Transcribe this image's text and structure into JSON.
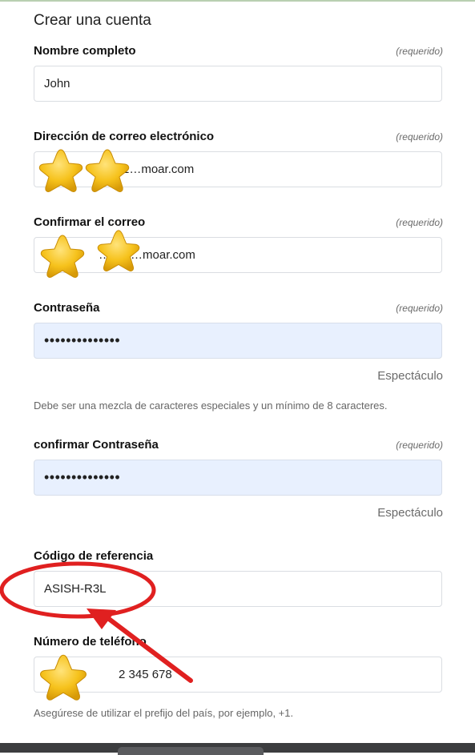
{
  "form": {
    "title": "Crear una cuenta",
    "required_text": "(requerido)",
    "full_name": {
      "label": "Nombre completo",
      "value": "John"
    },
    "email": {
      "label": "Dirección de correo electrónico",
      "value": "1…moar.com"
    },
    "confirm_email": {
      "label": "Confirmar el correo",
      "value": "…194…moar.com"
    },
    "password": {
      "label": "Contraseña",
      "value": "••••••••••••••",
      "show_label": "Espectáculo",
      "hint": "Debe ser una mezcla de caracteres especiales y un mínimo de 8 caracteres."
    },
    "confirm_password": {
      "label": "confirmar Contraseña",
      "value": "••••••••••••••",
      "show_label": "Espectáculo"
    },
    "referral": {
      "label": "Código de referencia",
      "value": "ASISH-R3L"
    },
    "phone": {
      "label": "Número de teléfono",
      "value": "2 345 678",
      "hint": "Asegúrese de utilizar el prefijo del país, por ejemplo, +1."
    }
  },
  "annotation": {
    "color": "#e02020",
    "shape": "circle-and-arrow",
    "target": "referral-code"
  },
  "stickers": {
    "icon": "star-emoji",
    "color": "#f5c518"
  }
}
